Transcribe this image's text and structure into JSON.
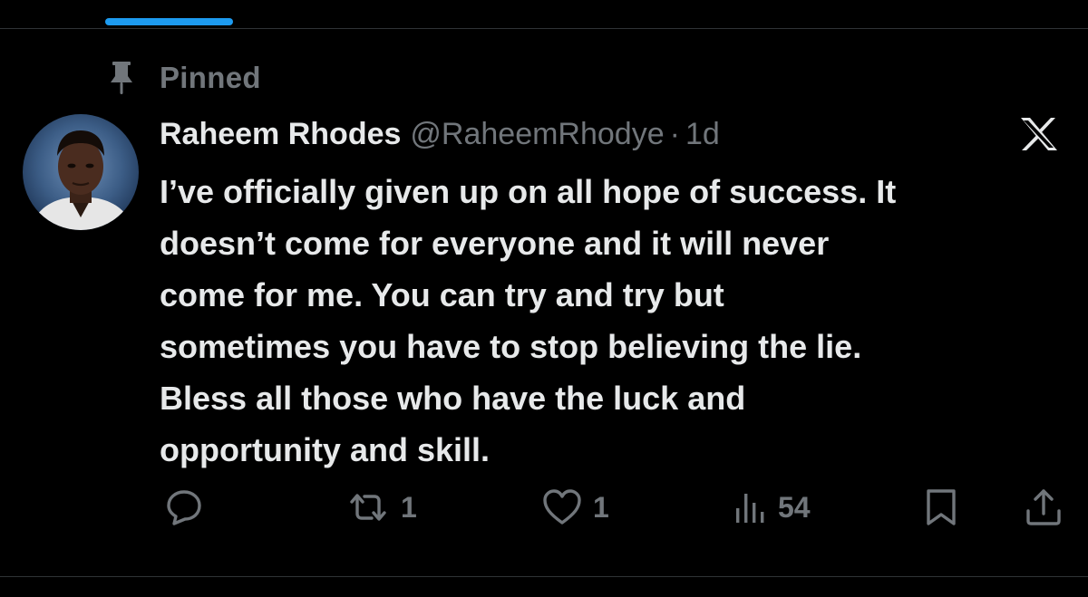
{
  "colors": {
    "background": "#000000",
    "primary_text": "#e7e9ea",
    "secondary_text": "#71767b",
    "accent": "#1d9bf0",
    "divider": "#2f3336"
  },
  "pinned": {
    "label": "Pinned",
    "icon": "pin-icon"
  },
  "tweet": {
    "author_name": "Raheem Rhodes",
    "author_handle": "@RaheemRhodye",
    "separator": "·",
    "time": "1d",
    "platform_icon": "x-logo-icon",
    "lines": [
      "I’ve officially given up on all hope of success. It",
      "doesn’t come for everyone and it will never",
      "come for me. You can try and try but",
      "sometimes you have to stop believing the lie.",
      "Bless all those who have the luck and",
      "opportunity and skill."
    ]
  },
  "actions": {
    "reply": {
      "icon": "reply-icon",
      "count": ""
    },
    "retweet": {
      "icon": "retweet-icon",
      "count": "1"
    },
    "like": {
      "icon": "heart-icon",
      "count": "1"
    },
    "views": {
      "icon": "views-icon",
      "count": "54"
    },
    "bookmark": {
      "icon": "bookmark-icon"
    },
    "share": {
      "icon": "share-icon"
    }
  }
}
